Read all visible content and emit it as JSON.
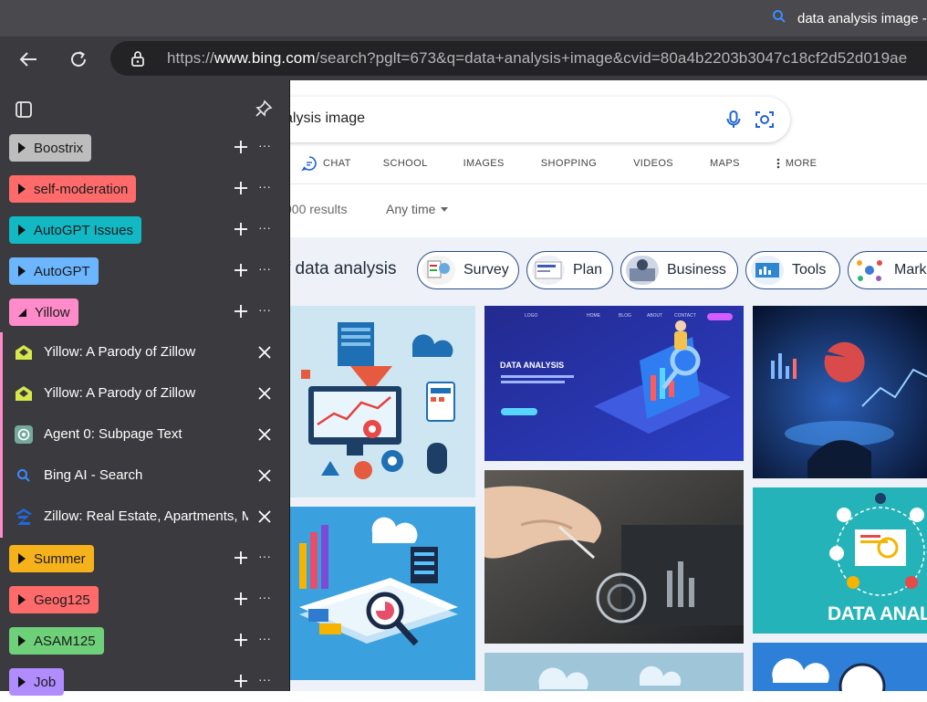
{
  "window": {
    "tab_title": "data analysis image -"
  },
  "toolbar": {
    "url_prefix": "https://",
    "url_host": "www.bing.com",
    "url_path": "/search?pglt=673&q=data+analysis+image&cvid=80a4b2203b3047c18cf2d52d019ae"
  },
  "bing": {
    "query_visible": "alysis image",
    "nav": [
      "CHAT",
      "SCHOOL",
      "IMAGES",
      "SHOPPING",
      "VIDEOS",
      "MAPS",
      "MORE"
    ],
    "results_count": "000 results",
    "time_filter": "Any time",
    "section_title": "f data analysis",
    "chips": [
      "Survey",
      "Plan",
      "Business",
      "Tools",
      "Marke"
    ],
    "tile_texts": {
      "landing_heading": "DATA ANALYSIS",
      "landing_nav": [
        "LOGO",
        "HOME",
        "BLOG",
        "ABOUT",
        "CONTACT"
      ],
      "teal_banner": "DATA ANALYSIS"
    }
  },
  "sidebar": {
    "groups_top": [
      {
        "label": "Boostrix",
        "color": "#bdbdbd"
      },
      {
        "label": "self-moderation",
        "color": "#ff6b6b"
      },
      {
        "label": "AutoGPT Issues",
        "color": "#12b8c4"
      },
      {
        "label": "AutoGPT",
        "color": "#6cb6ff"
      },
      {
        "label": "Yillow",
        "color": "#ff8bcb"
      }
    ],
    "yillow_tabs": [
      {
        "title": "Yillow: A Parody of Zillow",
        "icon": "yillow-house-icon"
      },
      {
        "title": "Yillow: A Parody of Zillow",
        "icon": "yillow-house-icon"
      },
      {
        "title": "Agent 0: Subpage Text",
        "icon": "openai-icon"
      },
      {
        "title": "Bing AI - Search",
        "icon": "search-icon"
      },
      {
        "title": "Zillow: Real Estate, Apartments, M",
        "icon": "zillow-z-icon"
      }
    ],
    "groups_bottom": [
      {
        "label": "Summer",
        "color": "#f6b21a"
      },
      {
        "label": "Geog125",
        "color": "#ff6b6b"
      },
      {
        "label": "ASAM125",
        "color": "#6fd07a"
      },
      {
        "label": "Job",
        "color": "#b08cff"
      }
    ],
    "more_glyph": "···"
  }
}
